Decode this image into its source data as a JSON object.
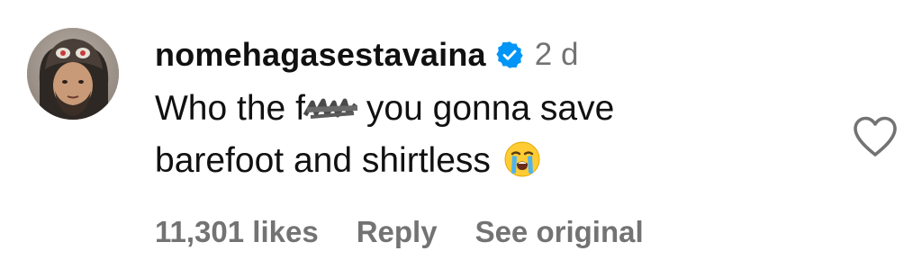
{
  "comment": {
    "username": "nomehagasestavaina",
    "verified_icon": "verified-badge-icon",
    "timestamp": "2 d",
    "text_line_1_before": "Who the f",
    "text_line_1_after": "you gonna save",
    "text_line_2": "barefoot and shirtless",
    "emoji": "loudly-crying-face",
    "likes_label": "11,301 likes",
    "reply_label": "Reply",
    "see_original_label": "See original",
    "like_icon": "heart-outline-icon"
  },
  "colors": {
    "text": "#111111",
    "muted": "#737373",
    "verified_blue": "#0095f6",
    "background": "#ffffff"
  }
}
